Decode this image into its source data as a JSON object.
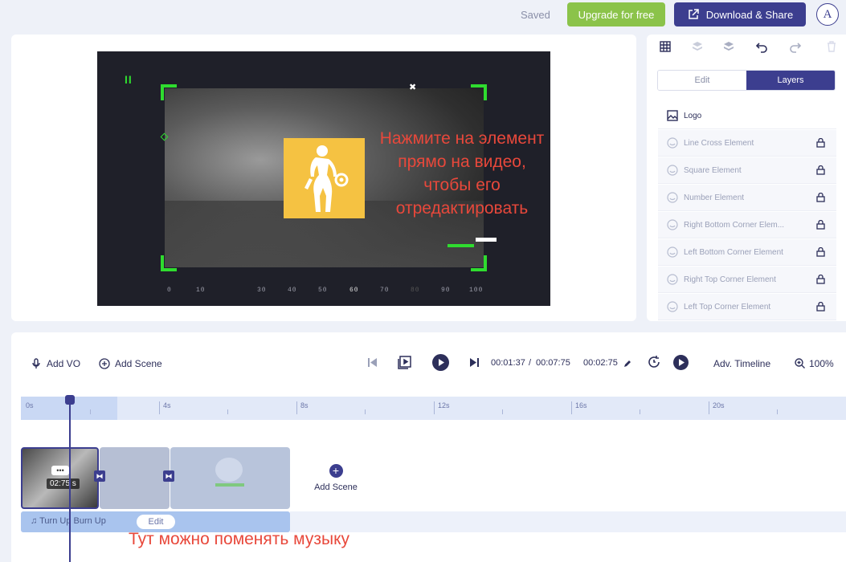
{
  "header": {
    "saved_label": "Saved",
    "upgrade_label": "Upgrade for free",
    "download_label": "Download & Share",
    "avatar_letter": "A"
  },
  "preview": {
    "overlay_text_lines": [
      "Нажмите на элемент",
      "прямо на видео,",
      "чтобы его",
      "отредактировать"
    ],
    "ruler_ticks": [
      "0",
      "10",
      "30",
      "40",
      "50",
      "60",
      "70",
      "80",
      "90",
      "100"
    ]
  },
  "right_panel": {
    "tabs": [
      "Edit",
      "Layers"
    ],
    "active_tab": "Layers",
    "layers": [
      {
        "label": "Logo",
        "locked": false
      },
      {
        "label": "Line Cross Element",
        "locked": true
      },
      {
        "label": "Square Element",
        "locked": true
      },
      {
        "label": "Number Element",
        "locked": true
      },
      {
        "label": "Right Bottom Corner Elem...",
        "locked": true
      },
      {
        "label": "Left Bottom Corner Element",
        "locked": true
      },
      {
        "label": "Right Top Corner Element",
        "locked": true
      },
      {
        "label": "Left Top Corner Element",
        "locked": true
      }
    ]
  },
  "timeline": {
    "add_vo_label": "Add VO",
    "add_scene_label": "Add Scene",
    "current_time": "00:01:37",
    "separator": "/",
    "total_time": "00:07:75",
    "scene_duration": "00:02:75",
    "adv_timeline_label": "Adv. Timeline",
    "zoom": "100%",
    "ruler_labels": [
      "0s",
      "4s",
      "8s",
      "12s",
      "16s",
      "20s"
    ],
    "scene1_duration_badge": "02:75 s",
    "add_scene_track_label": "Add Scene",
    "music_track_label": "Turn Up Burn Up",
    "music_edit_label": "Edit",
    "music_hint_text": "Тут можно поменять музыку"
  },
  "colors": {
    "accent": "#3c3e8f",
    "upgrade_green": "#8bc34a",
    "annotation_red": "#e8483b",
    "corner_green": "#2fdc2f",
    "logo_yellow": "#f5c242"
  }
}
